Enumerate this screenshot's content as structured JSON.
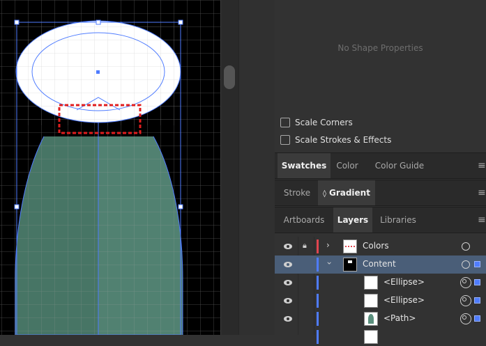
{
  "properties": {
    "empty_message": "No Shape Properties",
    "scale_corners": {
      "label": "Scale Corners",
      "checked": false
    },
    "scale_strokes": {
      "label": "Scale Strokes & Effects",
      "checked": false
    }
  },
  "panel_group_1": {
    "tabs": [
      {
        "label": "Swatches",
        "active": true
      },
      {
        "label": "Color",
        "active": false
      },
      {
        "label": "Color Guide",
        "active": false
      }
    ],
    "menu_icon": "hamburger-menu-icon"
  },
  "panel_group_2": {
    "tabs": [
      {
        "label": "Stroke",
        "active": false
      },
      {
        "label": "Gradient",
        "active": true,
        "prefix": "◊"
      }
    ],
    "menu_icon": "hamburger-menu-icon"
  },
  "panel_group_3": {
    "tabs": [
      {
        "label": "Artboards",
        "active": false
      },
      {
        "label": "Layers",
        "active": true
      },
      {
        "label": "Libraries",
        "active": false
      }
    ],
    "menu_icon": "hamburger-menu-icon"
  },
  "layers": [
    {
      "name": "Colors",
      "visible": true,
      "locked": true,
      "color": "#e0454f",
      "expanded": false,
      "selected": false,
      "level": 0
    },
    {
      "name": "Content",
      "visible": true,
      "locked": false,
      "color": "#4f7cff",
      "expanded": true,
      "selected": true,
      "level": 0
    },
    {
      "name": "<Ellipse>",
      "visible": true,
      "locked": false,
      "color": "#4f7cff",
      "selected": false,
      "level": 1
    },
    {
      "name": "<Ellipse>",
      "visible": true,
      "locked": false,
      "color": "#4f7cff",
      "selected": false,
      "level": 1
    },
    {
      "name": "<Path>",
      "visible": true,
      "locked": false,
      "color": "#4f7cff",
      "selected": false,
      "level": 1
    }
  ],
  "colors": {
    "canvas_bg": "#000000",
    "grid": "#ffffff",
    "selection_blue": "#4f7cff",
    "shape_green": "#5a8f7d",
    "highlight_red": "#e01e1e"
  }
}
